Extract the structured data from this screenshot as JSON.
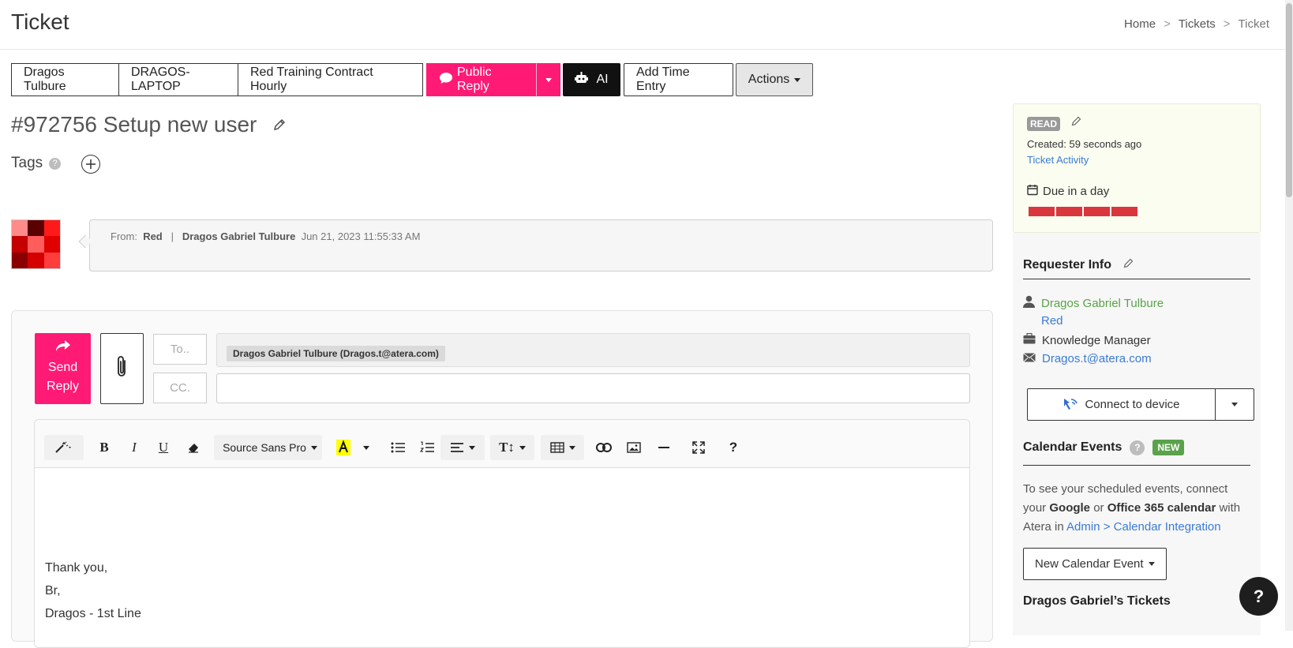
{
  "header": {
    "title": "Ticket",
    "breadcrumb": [
      "Home",
      "Tickets",
      "Ticket"
    ],
    "separator": ">"
  },
  "buttons": {
    "customer": "Dragos Tulbure",
    "device": "DRAGOS-LAPTOP",
    "contract": "Red Training Contract Hourly",
    "public_reply": "Public Reply",
    "ai": "AI",
    "add_time": "Add Time Entry",
    "actions": "Actions"
  },
  "ticket": {
    "title": "#972756 Setup new user",
    "tags_label": "Tags",
    "help_glyph": "?"
  },
  "message": {
    "from_label": "From:",
    "from_company": "Red",
    "separator": "|",
    "from_name": "Dragos Gabriel Tulbure",
    "date": "Jun 21, 2023 11:55:33 AM"
  },
  "reply": {
    "send_label_1": "Send",
    "send_label_2": "Reply",
    "to_label": "To..",
    "cc_label": "CC.",
    "to_recipient": "Dragos Gabriel Tulbure (Dragos.t@atera.com)",
    "font_name": "Source Sans Pro",
    "help_glyph": "?",
    "body_lines": [
      "Thank you,",
      "Br,",
      "Dragos - 1st Line"
    ]
  },
  "sidebar": {
    "status": "READ",
    "created": "Created: 59 seconds ago",
    "activity_link": "Ticket Activity",
    "due": "Due in a day",
    "due_level": 4,
    "requester_title": "Requester Info",
    "requester_name": "Dragos Gabriel Tulbure",
    "requester_company": "Red",
    "requester_role": "Knowledge Manager",
    "requester_email": "Dragos.t@atera.com",
    "connect_label": "Connect to device",
    "calendar_title": "Calendar Events",
    "calendar_help": "?",
    "new_badge": "NEW",
    "cal_text_1": "To see your scheduled events, connect your ",
    "cal_google": "Google",
    "cal_or": " or ",
    "cal_office": "Office 365 calendar",
    "cal_text_2": " with Atera in ",
    "cal_link": "Admin > Calendar Integration",
    "new_cal_event": "New Calendar Event",
    "tickets_title": "Dragos Gabriel’s Tickets"
  },
  "help_fab": "?",
  "colors": {
    "accent_pink": "#ff1a75",
    "status_green": "#5aa34a",
    "link_blue": "#3a7bd5",
    "due_red": "#d9363e"
  },
  "avatar_colors": [
    "#ff8a8a",
    "#5a0000",
    "#ff1a1a",
    "#c40000",
    "#ff5c5c",
    "#e00000",
    "#8a0000",
    "#d40000",
    "#ff3d3d"
  ]
}
